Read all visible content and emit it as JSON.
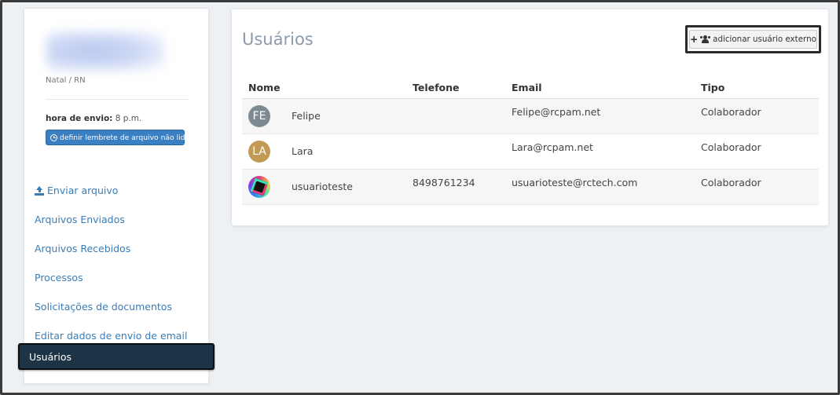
{
  "sidebar": {
    "location": "Natal / RN",
    "send_time_label": "hora de envio:",
    "send_time_value": "8 p.m.",
    "reminder_button": "definir lembrete de arquivo não lido",
    "nav": [
      {
        "label": "Enviar arquivo",
        "icon": "upload-icon"
      },
      {
        "label": "Arquivos Enviados"
      },
      {
        "label": "Arquivos Recebidos"
      },
      {
        "label": "Processos"
      },
      {
        "label": "Solicitações de documentos"
      },
      {
        "label": "Editar dados de envio de email"
      },
      {
        "label": "Usuários",
        "active": true
      }
    ]
  },
  "main": {
    "title": "Usuários",
    "add_button": "adicionar usuário externo",
    "table": {
      "headers": [
        "Nome",
        "Telefone",
        "Email",
        "Tipo"
      ],
      "rows": [
        {
          "initials": "FE",
          "name": "Felipe",
          "phone": "",
          "email": "Felipe@rcpam.net",
          "type": "Colaborador",
          "avatar_color": "#7d8a92"
        },
        {
          "initials": "LA",
          "name": "Lara",
          "phone": "",
          "email": "Lara@rcpam.net",
          "type": "Colaborador",
          "avatar_color": "#c39a53"
        },
        {
          "initials": "",
          "name": "usuarioteste",
          "phone": "8498761234",
          "email": "usuarioteste@rctech.com",
          "type": "Colaborador"
        }
      ]
    }
  },
  "colors": {
    "accent": "#3a7fc1",
    "link": "#3a7cb5",
    "active_nav_bg": "#1d3447",
    "title": "#8b9bab",
    "page_bg": "#eef1f3"
  }
}
